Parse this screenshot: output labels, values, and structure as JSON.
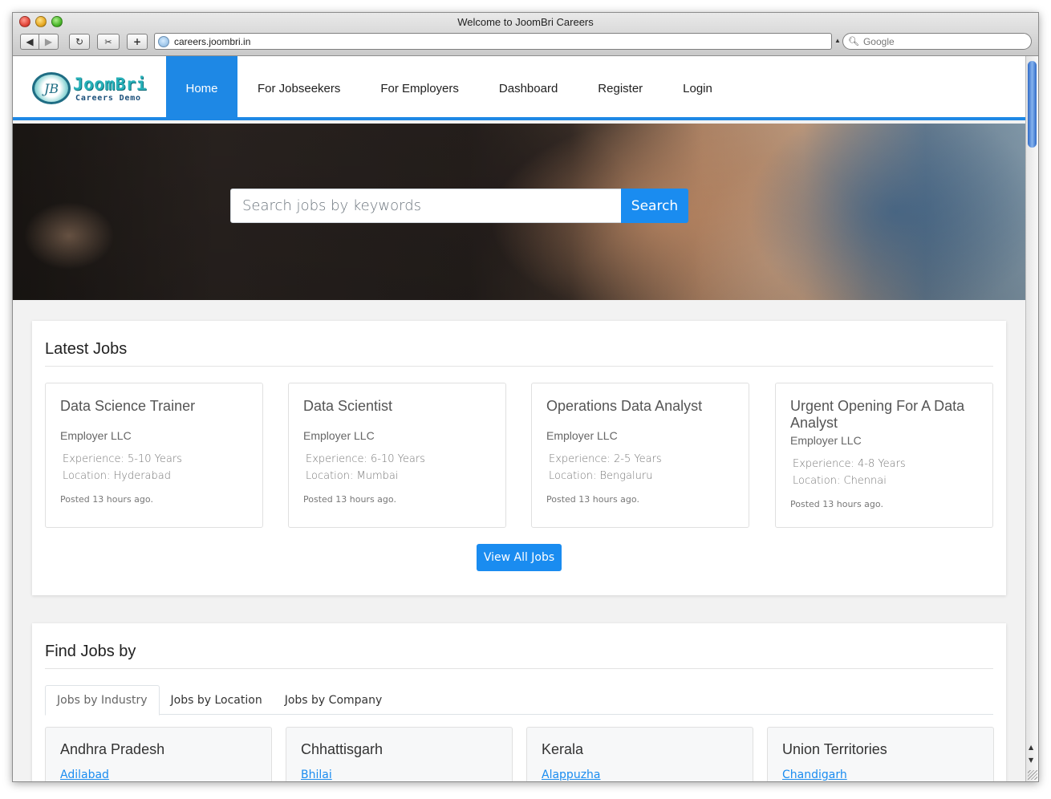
{
  "browser": {
    "window_title": "Welcome to JoomBri Careers",
    "url": "careers.joombri.in",
    "search_placeholder": "Google",
    "icons": [
      "back-icon",
      "forward-icon",
      "reload-icon",
      "snip-icon",
      "new-tab-icon",
      "globe-icon",
      "search-icon"
    ]
  },
  "brand": {
    "name": "JoomBri",
    "tagline": "Careers Demo",
    "accent": "#1e88e5",
    "button_color": "#1a8cf0"
  },
  "nav": {
    "items": [
      "Home",
      "For Jobseekers",
      "For Employers",
      "Dashboard",
      "Register",
      "Login"
    ],
    "active": "Home"
  },
  "hero": {
    "search_placeholder": "Search jobs by keywords",
    "search_button": "Search"
  },
  "latest": {
    "title": "Latest Jobs",
    "jobs": [
      {
        "title": "Data Science Trainer",
        "company": "Employer LLC",
        "experience": "Experience: 5-10 Years",
        "location": "Location: Hyderabad",
        "posted": "Posted 13 hours ago."
      },
      {
        "title": "Data Scientist",
        "company": "Employer LLC",
        "experience": "Experience: 6-10 Years",
        "location": "Location: Mumbai",
        "posted": "Posted 13 hours ago."
      },
      {
        "title": "Operations Data Analyst",
        "company": "Employer LLC",
        "experience": "Experience: 2-5 Years",
        "location": "Location: Bengaluru",
        "posted": "Posted 13 hours ago."
      },
      {
        "title": "Urgent Opening For A Data Analyst",
        "company": "Employer LLC",
        "experience": "Experience: 4-8 Years",
        "location": "Location: Chennai",
        "posted": "Posted 13 hours ago."
      }
    ],
    "view_all": "View All Jobs"
  },
  "find": {
    "title": "Find Jobs by",
    "tabs": [
      "Jobs by Industry",
      "Jobs by Location",
      "Jobs by Company"
    ],
    "active_tab": "Jobs by Industry",
    "groups": [
      {
        "title": "Andhra Pradesh",
        "first_link": "Adilabad"
      },
      {
        "title": "Chhattisgarh",
        "first_link": "Bhilai"
      },
      {
        "title": "Kerala",
        "first_link": "Alappuzha"
      },
      {
        "title": "Union Territories",
        "first_link": "Chandigarh"
      }
    ]
  }
}
